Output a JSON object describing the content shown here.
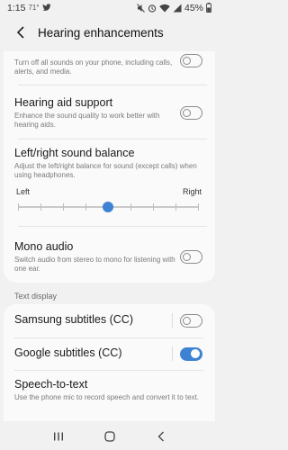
{
  "status_bar": {
    "time": "1:15",
    "temperature": "71°",
    "battery": "45%",
    "icons": [
      "twitter-icon",
      "mute-icon",
      "alarm-icon",
      "wifi-icon",
      "signal-icon",
      "battery-icon"
    ]
  },
  "header": {
    "back_icon": "back-arrow-icon",
    "title": "Hearing enhancements"
  },
  "settings": {
    "mute_all": {
      "desc": "Turn off all sounds on your phone, including calls, alerts, and media.",
      "enabled": false
    },
    "hearing_aid": {
      "title": "Hearing aid support",
      "desc": "Enhance the sound quality to work better with hearing aids.",
      "enabled": false
    },
    "balance": {
      "title": "Left/right sound balance",
      "desc": "Adjust the left/right balance for sound (except calls) when using headphones.",
      "left_label": "Left",
      "right_label": "Right",
      "ticks": 9,
      "value": 0.5
    },
    "mono_audio": {
      "title": "Mono audio",
      "desc": "Switch audio from stereo to mono for listening with one ear.",
      "enabled": false
    }
  },
  "text_display": {
    "section_title": "Text display",
    "samsung_subtitles": {
      "title": "Samsung subtitles (CC)",
      "enabled": false
    },
    "google_subtitles": {
      "title": "Google subtitles (CC)",
      "enabled": true
    },
    "speech_to_text": {
      "title": "Speech-to-text",
      "desc": "Use the phone mic to record speech and convert it to text."
    }
  },
  "nav_bar": {
    "icons": [
      "recents-icon",
      "home-icon",
      "back-icon"
    ]
  },
  "colors": {
    "accent": "#3e82d4",
    "background": "#f1f1f1",
    "card": "#fafafa"
  }
}
